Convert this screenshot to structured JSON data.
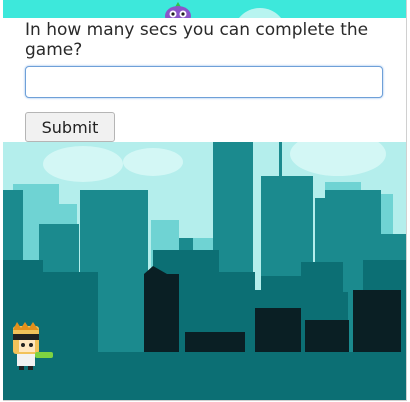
{
  "quiz": {
    "question": "In how many secs you can complete the game?",
    "answer_value": "",
    "submit_label": "Submit"
  },
  "theme": {
    "sky_top": "#3de8db",
    "sky": "#b4eeec",
    "far_buildings": "#6fd3d3",
    "mid_buildings": "#1b8a8e",
    "near_buildings": "#0c6f74",
    "dark_buildings": "#0a1f24"
  },
  "sprites": {
    "enemy": "purple-monster-icon",
    "player": "ninja-character-icon"
  }
}
